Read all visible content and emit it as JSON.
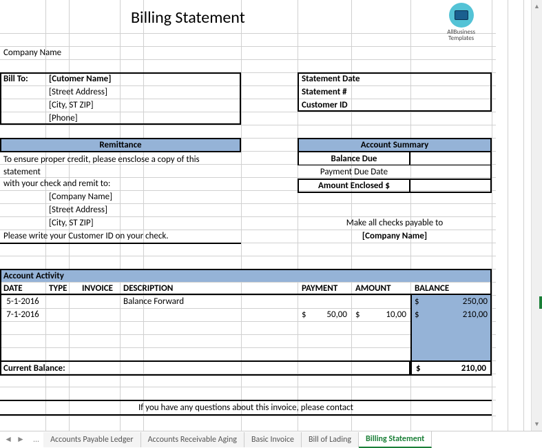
{
  "title": "Billing Statement",
  "logo": {
    "line1": "AllBusiness",
    "line2": "Templates"
  },
  "company_name_label": "Company Name",
  "bill_to": {
    "label": "Bill To:",
    "customer": "[Cutomer Name]",
    "street": "[Street Address]",
    "city": "[City, ST ZIP]",
    "phone": "[Phone]"
  },
  "statement": {
    "date_label": "Statement Date",
    "num_label": "Statement #",
    "cust_id_label": "Customer ID"
  },
  "remittance": {
    "header": "Remittance",
    "line1": "To ensure proper credit, please ensclose a copy of this statement",
    "line2": "with your check and remit to:",
    "company": "[Company Name]",
    "street": "[Street Address]",
    "city": "[City, ST ZIP]",
    "line3": "Please write your Customer ID on your check."
  },
  "summary": {
    "header": "Account Summary",
    "balance_due": "Balance Due",
    "payment_due": "Payment Due Date",
    "amount_enclosed": "Amount Enclosed $",
    "payable": "Make all checks payable to",
    "company": "[Company Name]"
  },
  "activity": {
    "header": "Account Activity",
    "cols": {
      "date": "DATE",
      "type": "TYPE",
      "invoice": "INVOICE",
      "desc": "DESCRIPTION",
      "payment": "PAYMENT",
      "amount": "AMOUNT",
      "balance": "BALANCE"
    },
    "rows": [
      {
        "date": "5-1-2016",
        "type": "",
        "invoice": "",
        "desc": "Balance Forward",
        "payment": "",
        "amount": "",
        "bal_sym": "$",
        "balance": "250,00"
      },
      {
        "date": "7-1-2016",
        "type": "",
        "invoice": "",
        "desc": "",
        "pay_sym": "$",
        "payment": "50,00",
        "amt_sym": "$",
        "amount": "10,00",
        "bal_sym": "$",
        "balance": "210,00"
      }
    ],
    "current_label": "Current Balance:",
    "current_sym": "$",
    "current_val": "210,00"
  },
  "footer": "If you have any questions about this invoice, please contact",
  "tabs": {
    "dots": "...",
    "items": [
      "Accounts Payable Ledger",
      "Accounts Receivable Aging",
      "Basic Invoice",
      "Bill of Lading",
      "Billing Statement"
    ],
    "active": "Billing Statement"
  }
}
